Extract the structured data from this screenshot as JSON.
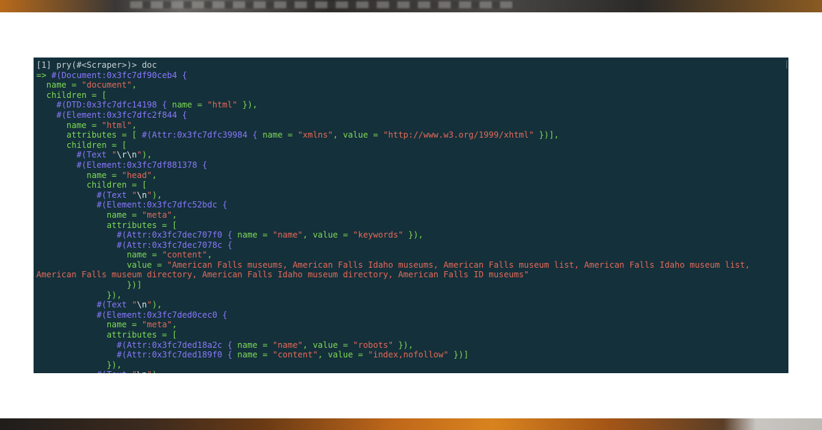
{
  "terminal": {
    "lines": [
      [
        {
          "t": "[1] pry(#<Scraper>)> doc",
          "c": "grey"
        }
      ],
      [
        {
          "t": "=> ",
          "c": "green"
        },
        {
          "t": "#(Document:0x3fc7df90ceb4 {",
          "c": "purple"
        }
      ],
      [
        {
          "t": "  name = ",
          "c": "green"
        },
        {
          "t": "\"document\"",
          "c": "red"
        },
        {
          "t": ",",
          "c": "green"
        }
      ],
      [
        {
          "t": "  children = [",
          "c": "green"
        }
      ],
      [
        {
          "t": "    ",
          "c": "green"
        },
        {
          "t": "#(DTD:0x3fc7dfc14198 {",
          "c": "purple"
        },
        {
          "t": " name = ",
          "c": "green"
        },
        {
          "t": "\"html\"",
          "c": "red"
        },
        {
          "t": " }),",
          "c": "green"
        }
      ],
      [
        {
          "t": "    ",
          "c": "green"
        },
        {
          "t": "#(Element:0x3fc7dfc2f844 {",
          "c": "purple"
        }
      ],
      [
        {
          "t": "      name = ",
          "c": "green"
        },
        {
          "t": "\"html\"",
          "c": "red"
        },
        {
          "t": ",",
          "c": "green"
        }
      ],
      [
        {
          "t": "      attributes = [ ",
          "c": "green"
        },
        {
          "t": "#(Attr:0x3fc7dfc39984 {",
          "c": "purple"
        },
        {
          "t": " name = ",
          "c": "green"
        },
        {
          "t": "\"xmlns\"",
          "c": "red"
        },
        {
          "t": ", value = ",
          "c": "green"
        },
        {
          "t": "\"http://www.w3.org/1999/xhtml\"",
          "c": "red"
        },
        {
          "t": " })],",
          "c": "green"
        }
      ],
      [
        {
          "t": "      children = [",
          "c": "green"
        }
      ],
      [
        {
          "t": "        ",
          "c": "green"
        },
        {
          "t": "#(Text ",
          "c": "purple"
        },
        {
          "t": "\"",
          "c": "red"
        },
        {
          "t": "\\r\\n",
          "c": "white"
        },
        {
          "t": "\"",
          "c": "red"
        },
        {
          "t": "),",
          "c": "green"
        }
      ],
      [
        {
          "t": "        ",
          "c": "green"
        },
        {
          "t": "#(Element:0x3fc7df881378 {",
          "c": "purple"
        }
      ],
      [
        {
          "t": "          name = ",
          "c": "green"
        },
        {
          "t": "\"head\"",
          "c": "red"
        },
        {
          "t": ",",
          "c": "green"
        }
      ],
      [
        {
          "t": "          children = [",
          "c": "green"
        }
      ],
      [
        {
          "t": "            ",
          "c": "green"
        },
        {
          "t": "#(Text ",
          "c": "purple"
        },
        {
          "t": "\"",
          "c": "red"
        },
        {
          "t": "\\n",
          "c": "white"
        },
        {
          "t": "\"",
          "c": "red"
        },
        {
          "t": "),",
          "c": "green"
        }
      ],
      [
        {
          "t": "            ",
          "c": "green"
        },
        {
          "t": "#(Element:0x3fc7dfc52bdc {",
          "c": "purple"
        }
      ],
      [
        {
          "t": "              name = ",
          "c": "green"
        },
        {
          "t": "\"meta\"",
          "c": "red"
        },
        {
          "t": ",",
          "c": "green"
        }
      ],
      [
        {
          "t": "              attributes = [",
          "c": "green"
        }
      ],
      [
        {
          "t": "                ",
          "c": "green"
        },
        {
          "t": "#(Attr:0x3fc7dec707f0 {",
          "c": "purple"
        },
        {
          "t": " name = ",
          "c": "green"
        },
        {
          "t": "\"name\"",
          "c": "red"
        },
        {
          "t": ", value = ",
          "c": "green"
        },
        {
          "t": "\"keywords\"",
          "c": "red"
        },
        {
          "t": " }),",
          "c": "green"
        }
      ],
      [
        {
          "t": "                ",
          "c": "green"
        },
        {
          "t": "#(Attr:0x3fc7dec7078c {",
          "c": "purple"
        }
      ],
      [
        {
          "t": "                  name = ",
          "c": "green"
        },
        {
          "t": "\"content\"",
          "c": "red"
        },
        {
          "t": ",",
          "c": "green"
        }
      ],
      [
        {
          "t": "                  value = ",
          "c": "green"
        },
        {
          "t": "\"American Falls museums, American Falls Idaho museums, American Falls museum list, American Falls Idaho museum list,",
          "c": "red"
        }
      ],
      [
        {
          "t": "American Falls museum directory, American Falls Idaho museum directory, American Falls ID museums\"",
          "c": "red"
        }
      ],
      [
        {
          "t": "                  })]",
          "c": "green"
        }
      ],
      [
        {
          "t": "              }),",
          "c": "green"
        }
      ],
      [
        {
          "t": "            ",
          "c": "green"
        },
        {
          "t": "#(Text ",
          "c": "purple"
        },
        {
          "t": "\"",
          "c": "red"
        },
        {
          "t": "\\n",
          "c": "white"
        },
        {
          "t": "\"",
          "c": "red"
        },
        {
          "t": "),",
          "c": "green"
        }
      ],
      [
        {
          "t": "            ",
          "c": "green"
        },
        {
          "t": "#(Element:0x3fc7ded0cec0 {",
          "c": "purple"
        }
      ],
      [
        {
          "t": "              name = ",
          "c": "green"
        },
        {
          "t": "\"meta\"",
          "c": "red"
        },
        {
          "t": ",",
          "c": "green"
        }
      ],
      [
        {
          "t": "              attributes = [",
          "c": "green"
        }
      ],
      [
        {
          "t": "                ",
          "c": "green"
        },
        {
          "t": "#(Attr:0x3fc7ded18a2c {",
          "c": "purple"
        },
        {
          "t": " name = ",
          "c": "green"
        },
        {
          "t": "\"name\"",
          "c": "red"
        },
        {
          "t": ", value = ",
          "c": "green"
        },
        {
          "t": "\"robots\"",
          "c": "red"
        },
        {
          "t": " }),",
          "c": "green"
        }
      ],
      [
        {
          "t": "                ",
          "c": "green"
        },
        {
          "t": "#(Attr:0x3fc7ded189f0 {",
          "c": "purple"
        },
        {
          "t": " name = ",
          "c": "green"
        },
        {
          "t": "\"content\"",
          "c": "red"
        },
        {
          "t": ", value = ",
          "c": "green"
        },
        {
          "t": "\"index,nofollow\"",
          "c": "red"
        },
        {
          "t": " })]",
          "c": "green"
        }
      ],
      [
        {
          "t": "              }),",
          "c": "green"
        }
      ],
      [
        {
          "t": "            ",
          "c": "green"
        },
        {
          "t": "#(Text ",
          "c": "purple"
        },
        {
          "t": "\"",
          "c": "red"
        },
        {
          "t": "\\n",
          "c": "white"
        },
        {
          "t": "\"",
          "c": "red"
        },
        {
          "t": "),",
          "c": "green"
        }
      ]
    ]
  },
  "colors": {
    "background": "#14303a",
    "prompt": "#c7d1d6",
    "syntax_green": "#7ed957",
    "object_purple": "#8a78ff",
    "string_red": "#e46a5a",
    "escape_white": "#dfe7ea"
  }
}
